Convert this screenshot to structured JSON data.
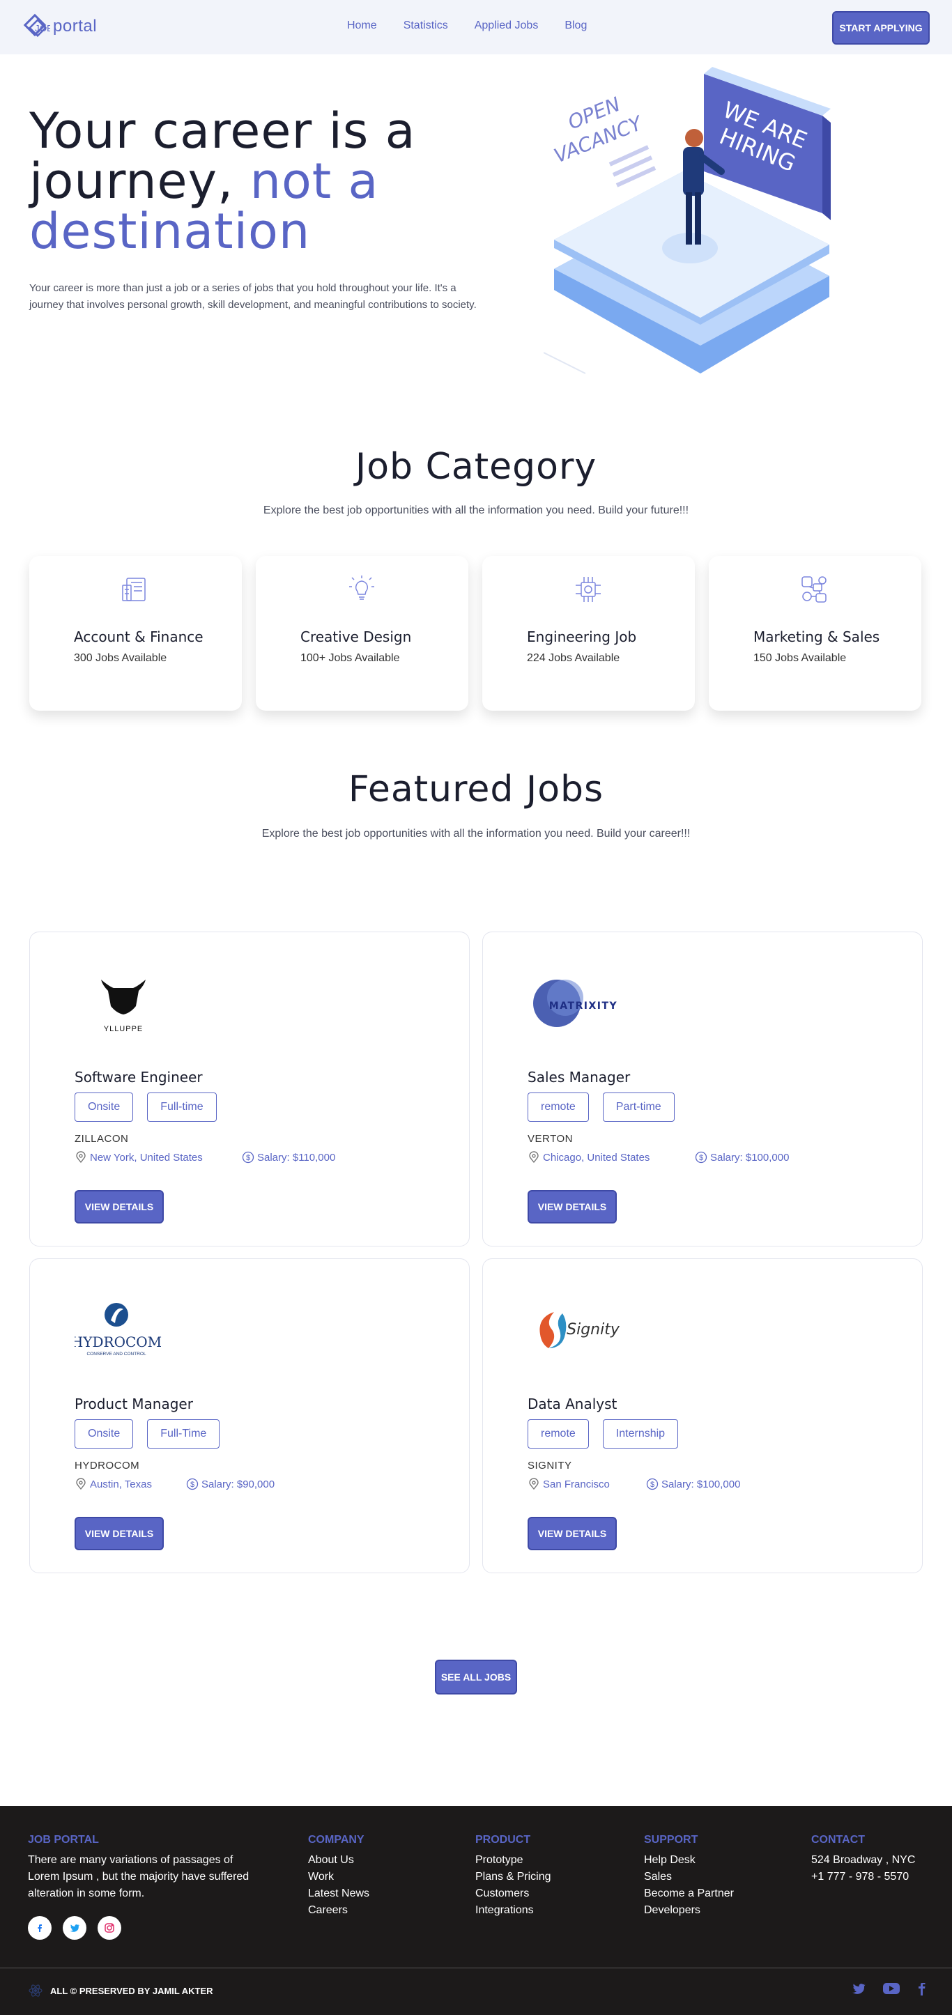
{
  "nav": {
    "logo_text": "portal",
    "links": [
      "Home",
      "Statistics",
      "Applied Jobs",
      "Blog"
    ],
    "cta": "START APPLYING"
  },
  "hero": {
    "title_line1": "Your career is a",
    "title_line2a": "journey,",
    "title_line2b": "not a",
    "title_line3": "destination",
    "description": "Your career is more than just a job or a series of jobs that you hold throughout your life. It's a journey that involves personal growth, skill development, and meaningful contributions to society.",
    "art_sign_left_1": "OPEN",
    "art_sign_left_2": "VACANCY",
    "art_sign_right_1": "WE ARE",
    "art_sign_right_2": "HIRING"
  },
  "categories": {
    "title": "Job Category",
    "subtitle": "Explore the best job opportunities with all the information you need. Build your future!!!",
    "items": [
      {
        "title": "Account & Finance",
        "count": "300 Jobs Available",
        "icon": "finance-icon"
      },
      {
        "title": "Creative Design",
        "count": "100+ Jobs Available",
        "icon": "lightbulb-icon"
      },
      {
        "title": "Engineering Job",
        "count": "224 Jobs Available",
        "icon": "chip-icon"
      },
      {
        "title": "Marketing & Sales",
        "count": "150 Jobs Available",
        "icon": "marketing-icon"
      }
    ]
  },
  "featured": {
    "title": "Featured Jobs",
    "subtitle": "Explore the best job opportunities with all the information you need. Build your career!!!",
    "view_label": "VIEW DETAILS",
    "jobs": [
      {
        "title": "Software Engineer",
        "tag1": "Onsite",
        "tag2": "Full-time",
        "company": "ZILLACON",
        "location": "New York, United States",
        "salary": "Salary: $110,000",
        "logo_text": "YLLUPPE"
      },
      {
        "title": "Sales Manager",
        "tag1": "remote",
        "tag2": "Part-time",
        "company": "VERTON",
        "location": "Chicago, United States",
        "salary": "Salary: $100,000",
        "logo_text": "MATRIXITY"
      },
      {
        "title": "Product Manager",
        "tag1": "Onsite",
        "tag2": "Full-Time",
        "company": "HYDROCOM",
        "location": "Austin, Texas",
        "salary": "Salary: $90,000",
        "logo_text": "HYDROCOM",
        "logo_sub": "CONSERVE AND CONTROL"
      },
      {
        "title": "Data Analyst",
        "tag1": "remote",
        "tag2": "Internship",
        "company": "SIGNITY",
        "location": "San Francisco",
        "salary": "Salary: $100,000",
        "logo_text": "Signity"
      }
    ],
    "see_all": "SEE ALL JOBS"
  },
  "footer": {
    "brand_head": "JOB PORTAL",
    "brand_text_1": "There are many variations of passages of",
    "brand_text_2": "Lorem Ipsum , but the majority have suffered",
    "brand_text_3": "alteration in some form.",
    "company_head": "COMPANY",
    "company": [
      "About Us",
      "Work",
      "Latest News",
      "Careers"
    ],
    "product_head": "PRODUCT",
    "product": [
      "Prototype",
      "Plans & Pricing",
      "Customers",
      "Integrations"
    ],
    "support_head": "SUPPORT",
    "support": [
      "Help Desk",
      "Sales",
      "Become a Partner",
      "Developers"
    ],
    "contact_head": "CONTACT",
    "contact": [
      "524 Broadway , NYC",
      "+1 777 - 978 - 5570"
    ],
    "copyright": "ALL © PRESERVED BY JAMIL AKTER"
  },
  "colors": {
    "accent": "#5965c5",
    "footer_bg": "#1c1a1a",
    "nav_bg": "#f2f4fa"
  }
}
